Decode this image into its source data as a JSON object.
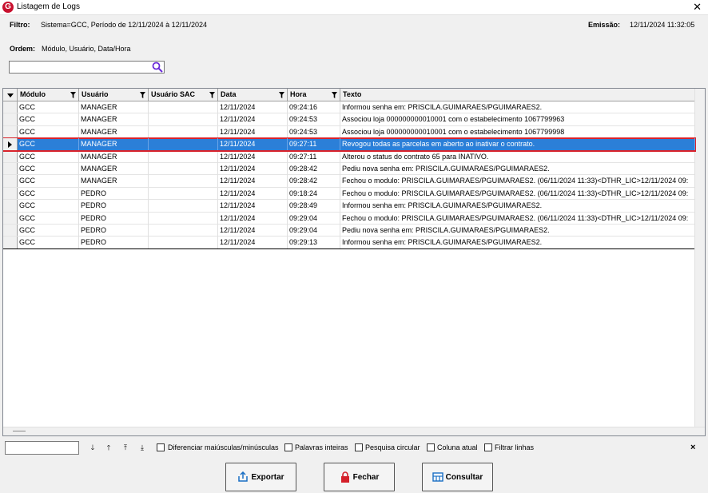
{
  "window": {
    "title": "Listagem de Logs",
    "logo": "G"
  },
  "header": {
    "filtro_label": "Filtro:",
    "filtro_value": "Sistema=GCC, Período de 12/11/2024 à 12/11/2024",
    "emissao_label": "Emissão:",
    "emissao_value": "12/11/2024 11:32:05",
    "ordem_label": "Ordem:",
    "ordem_value": "Módulo, Usuário, Data/Hora"
  },
  "search": {
    "value": "",
    "icon": "search-icon"
  },
  "grid": {
    "columns": [
      "Módulo",
      "Usuário",
      "Usuário SAC",
      "Data",
      "Hora",
      "Texto"
    ],
    "rows": [
      [
        "GCC",
        "MANAGER",
        "",
        "12/11/2024",
        "09:24:16",
        "Informou senha em: PRISCILA.GUIMARAES/PGUIMARAES2."
      ],
      [
        "GCC",
        "MANAGER",
        "",
        "12/11/2024",
        "09:24:53",
        "Associou loja 000000000010001 com o estabelecimento 1067799963"
      ],
      [
        "GCC",
        "MANAGER",
        "",
        "12/11/2024",
        "09:24:53",
        "Associou loja 000000000010001 com o estabelecimento 1067799998"
      ],
      [
        "GCC",
        "MANAGER",
        "",
        "12/11/2024",
        "09:27:11",
        "Revogou todas as parcelas em aberto ao inativar o contrato."
      ],
      [
        "GCC",
        "MANAGER",
        "",
        "12/11/2024",
        "09:27:11",
        "Alterou o status do contrato 65 para INATIVO."
      ],
      [
        "GCC",
        "MANAGER",
        "",
        "12/11/2024",
        "09:28:42",
        "Pediu nova senha em: PRISCILA.GUIMARAES/PGUIMARAES2."
      ],
      [
        "GCC",
        "MANAGER",
        "",
        "12/11/2024",
        "09:28:42",
        "Fechou o modulo: PRISCILA.GUIMARAES/PGUIMARAES2. (06/11/2024 11:33)<DTHR_LIC>12/11/2024 09:"
      ],
      [
        "GCC",
        "PEDRO",
        "",
        "12/11/2024",
        "09:18:24",
        "Fechou o modulo: PRISCILA.GUIMARAES/PGUIMARAES2. (06/11/2024 11:33)<DTHR_LIC>12/11/2024 09:"
      ],
      [
        "GCC",
        "PEDRO",
        "",
        "12/11/2024",
        "09:28:49",
        "Informou senha em: PRISCILA.GUIMARAES/PGUIMARAES2."
      ],
      [
        "GCC",
        "PEDRO",
        "",
        "12/11/2024",
        "09:29:04",
        "Fechou o modulo: PRISCILA.GUIMARAES/PGUIMARAES2. (06/11/2024 11:33)<DTHR_LIC>12/11/2024 09:"
      ],
      [
        "GCC",
        "PEDRO",
        "",
        "12/11/2024",
        "09:29:04",
        "Pediu nova senha em: PRISCILA.GUIMARAES/PGUIMARAES2."
      ],
      [
        "GCC",
        "PEDRO",
        "",
        "12/11/2024",
        "09:29:13",
        "Informou senha em: PRISCILA.GUIMARAES/PGUIMARAES2."
      ]
    ],
    "selected_row": 3,
    "selection_color": "#2b7fd8",
    "highlight_border_color": "#d9222a"
  },
  "findbar": {
    "value": "",
    "nav_icons": [
      "arrow-down-icon",
      "arrow-up-icon",
      "arrow-first-icon",
      "arrow-last-icon"
    ],
    "options": [
      "Diferenciar maiúsculas/minúsculas",
      "Palavras inteiras",
      "Pesquisa circular",
      "Coluna atual",
      "Filtrar linhas"
    ],
    "close_glyph": "×"
  },
  "buttons": {
    "exportar": "Exportar",
    "fechar": "Fechar",
    "consultar": "Consultar"
  },
  "colors": {
    "brand": "#c8102e",
    "search_icon": "#6a2bd9"
  }
}
